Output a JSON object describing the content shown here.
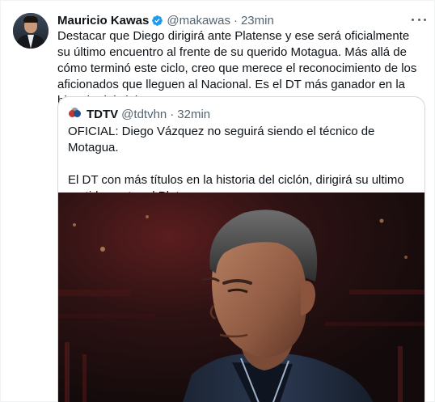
{
  "tweet": {
    "author_name": "Mauricio Kawas",
    "handle": "@makawas",
    "separator": "·",
    "time": "23min",
    "text": "Destacar que Diego dirigirá ante Platense y ese será oficialmente su último encuentro al frente de su querido Motagua. Más allá de cómo terminó este ciclo, creo que merece el reconocimiento de los aficionados que lleguen al Nacional. Es el DT más ganador en la historia del club."
  },
  "quoted_tweet": {
    "author_name": "TDTV",
    "handle": "@tdtvhn",
    "separator": "·",
    "time": "32min",
    "paragraph_1": "OFICIAL: Diego Vázquez no seguirá siendo el técnico de Motagua.",
    "paragraph_2": "El DT con más títulos en la historia del ciclón, dirigirá su ultimo partido contra el Platense."
  },
  "colors": {
    "verified_badge": "#1d9bf0",
    "secondary_text": "#536471",
    "border": "#cfd9de"
  },
  "icons": {
    "verified": "verified-badge-icon",
    "more": "more-options-icon"
  }
}
